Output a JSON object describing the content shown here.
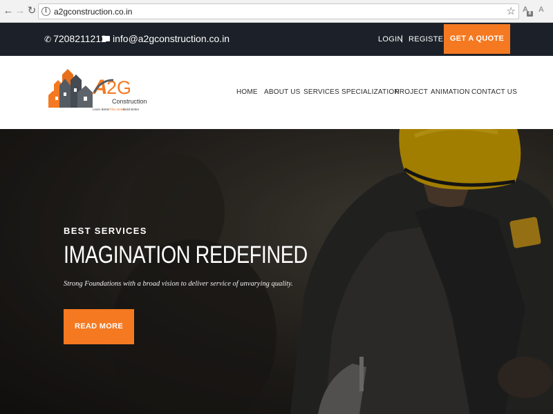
{
  "browser": {
    "url": "a2gconstruction.co.in"
  },
  "topbar": {
    "phone": "7208211212",
    "email": "info@a2gconstruction.co.in",
    "login": "LOGIN",
    "separator": "|",
    "register": "REGISTER",
    "quote_button": "GET A QUOTE"
  },
  "logo": {
    "brand": "A2G",
    "name": "Construction",
    "tagline_a": "Learn Better",
    "tagline_b": "Plan Better",
    "tagline_c": "Build Better"
  },
  "menu": {
    "items": [
      "HOME",
      "ABOUT US",
      "SERVICES",
      "SPECIALIZATION",
      "PROJECT",
      "ANIMATION",
      "CONTACT US"
    ]
  },
  "hero": {
    "kicker": "BEST SERVICES",
    "title": "IMAGINATION REDEFINED",
    "subtitle": "Strong Foundations with a broad vision to deliver service of unvarying quality.",
    "button": "READ MORE"
  },
  "colors": {
    "accent": "#f47921",
    "topbar": "#1c2129"
  }
}
